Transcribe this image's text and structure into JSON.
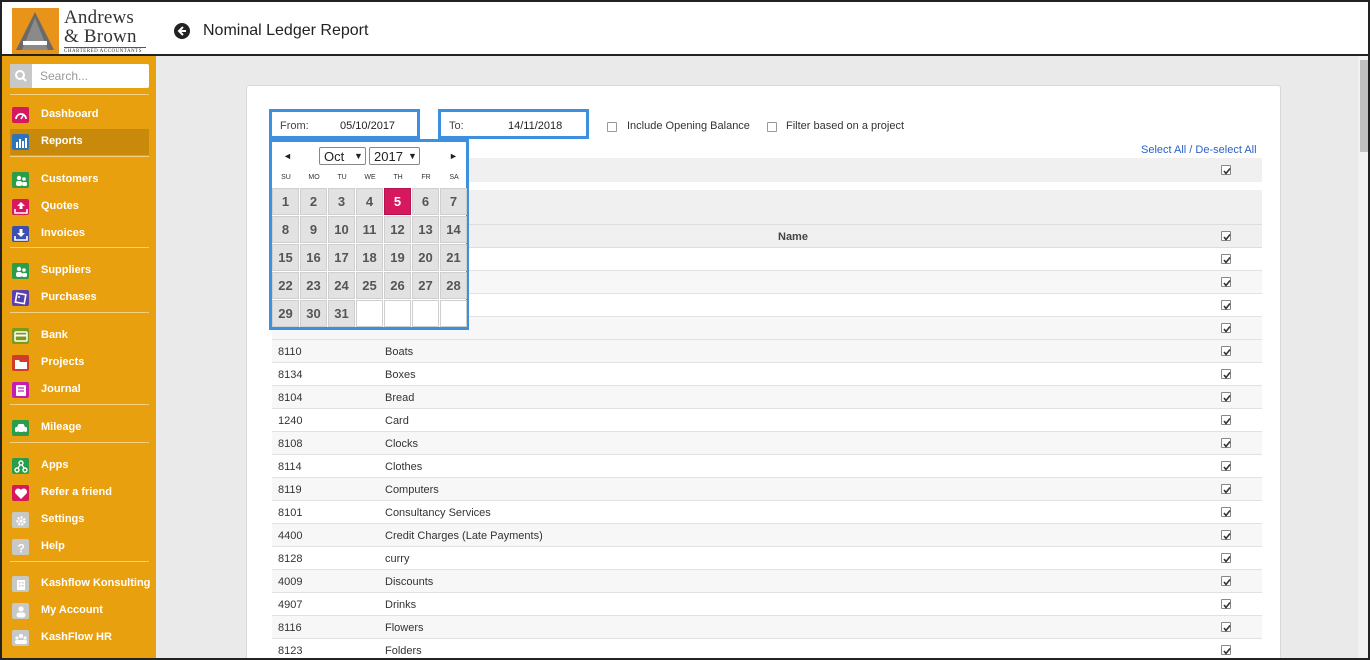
{
  "brand": {
    "line1": "Andrews",
    "line2": "& Brown",
    "sub": "CHARTERED ACCOUNTANTS",
    "accent": "#e8941a"
  },
  "header": {
    "title": "Nominal Ledger Report",
    "back_icon": "arrow-left-circle-icon"
  },
  "sidebar": {
    "color": "#e8a00f",
    "search_placeholder": "Search...",
    "items": [
      {
        "label": "Dashboard",
        "icon": "gauge-icon",
        "color": "#d6195f"
      },
      {
        "label": "Reports",
        "icon": "bar-chart-icon",
        "color": "#2d74b7",
        "active": true
      },
      {
        "label": "Customers",
        "icon": "users-icon",
        "color": "#2a9d4b"
      },
      {
        "label": "Quotes",
        "icon": "upload-icon",
        "color": "#d6195f"
      },
      {
        "label": "Invoices",
        "icon": "download-icon",
        "color": "#3c4fb0"
      },
      {
        "label": "Suppliers",
        "icon": "users-icon",
        "color": "#2a9d4b"
      },
      {
        "label": "Purchases",
        "icon": "tag-icon",
        "color": "#5b3fb0"
      },
      {
        "label": "Bank",
        "icon": "card-icon",
        "color": "#7b9a1a"
      },
      {
        "label": "Projects",
        "icon": "folder-icon",
        "color": "#d23a2a"
      },
      {
        "label": "Journal",
        "icon": "book-icon",
        "color": "#c21fb0"
      },
      {
        "label": "Mileage",
        "icon": "car-icon",
        "color": "#2a9d4b"
      },
      {
        "label": "Apps",
        "icon": "apps-icon",
        "color": "#2a9d4b"
      },
      {
        "label": "Refer a friend",
        "icon": "heart-icon",
        "color": "#d6195f"
      },
      {
        "label": "Settings",
        "icon": "gear-icon",
        "color": "#c8c8c8"
      },
      {
        "label": "Help",
        "icon": "question-icon",
        "color": "#c8c8c8"
      },
      {
        "label": "Kashflow Konsulting",
        "icon": "building-icon",
        "color": "#c8c8c8"
      },
      {
        "label": "My Account",
        "icon": "user-icon",
        "color": "#c8c8c8"
      },
      {
        "label": "KashFlow HR",
        "icon": "group-icon",
        "color": "#c8c8c8"
      }
    ]
  },
  "filters": {
    "from_label": "From:",
    "from_value": "05/10/2017",
    "to_label": "To:",
    "to_value": "14/11/2018",
    "opening_balance_label": "Include Opening Balance",
    "project_filter_label": "Filter based on a project",
    "select_all_label": "Select All / De-select All"
  },
  "datepicker": {
    "month": "Oct",
    "year": "2017",
    "prev": "◄",
    "next": "►",
    "weekdays": [
      "SU",
      "MO",
      "TU",
      "WE",
      "TH",
      "FR",
      "SA"
    ],
    "selected_day": 5,
    "weeks": [
      [
        1,
        2,
        3,
        4,
        5,
        6,
        7
      ],
      [
        8,
        9,
        10,
        11,
        12,
        13,
        14
      ],
      [
        15,
        16,
        17,
        18,
        19,
        20,
        21
      ],
      [
        22,
        23,
        24,
        25,
        26,
        27,
        28
      ],
      [
        29,
        30,
        31,
        null,
        null,
        null,
        null
      ]
    ],
    "selected_color": "#d6195f"
  },
  "table": {
    "name_header": "Name",
    "rows": [
      {
        "code": "8110",
        "name": "Boats"
      },
      {
        "code": "8134",
        "name": "Boxes"
      },
      {
        "code": "8104",
        "name": "Bread"
      },
      {
        "code": "1240",
        "name": "Card"
      },
      {
        "code": "8108",
        "name": "Clocks"
      },
      {
        "code": "8114",
        "name": "Clothes"
      },
      {
        "code": "8119",
        "name": "Computers"
      },
      {
        "code": "8101",
        "name": "Consultancy Services"
      },
      {
        "code": "4400",
        "name": "Credit Charges (Late Payments)"
      },
      {
        "code": "8128",
        "name": "curry"
      },
      {
        "code": "4009",
        "name": "Discounts"
      },
      {
        "code": "4907",
        "name": "Drinks"
      },
      {
        "code": "8116",
        "name": "Flowers"
      },
      {
        "code": "8123",
        "name": "Folders"
      }
    ]
  }
}
